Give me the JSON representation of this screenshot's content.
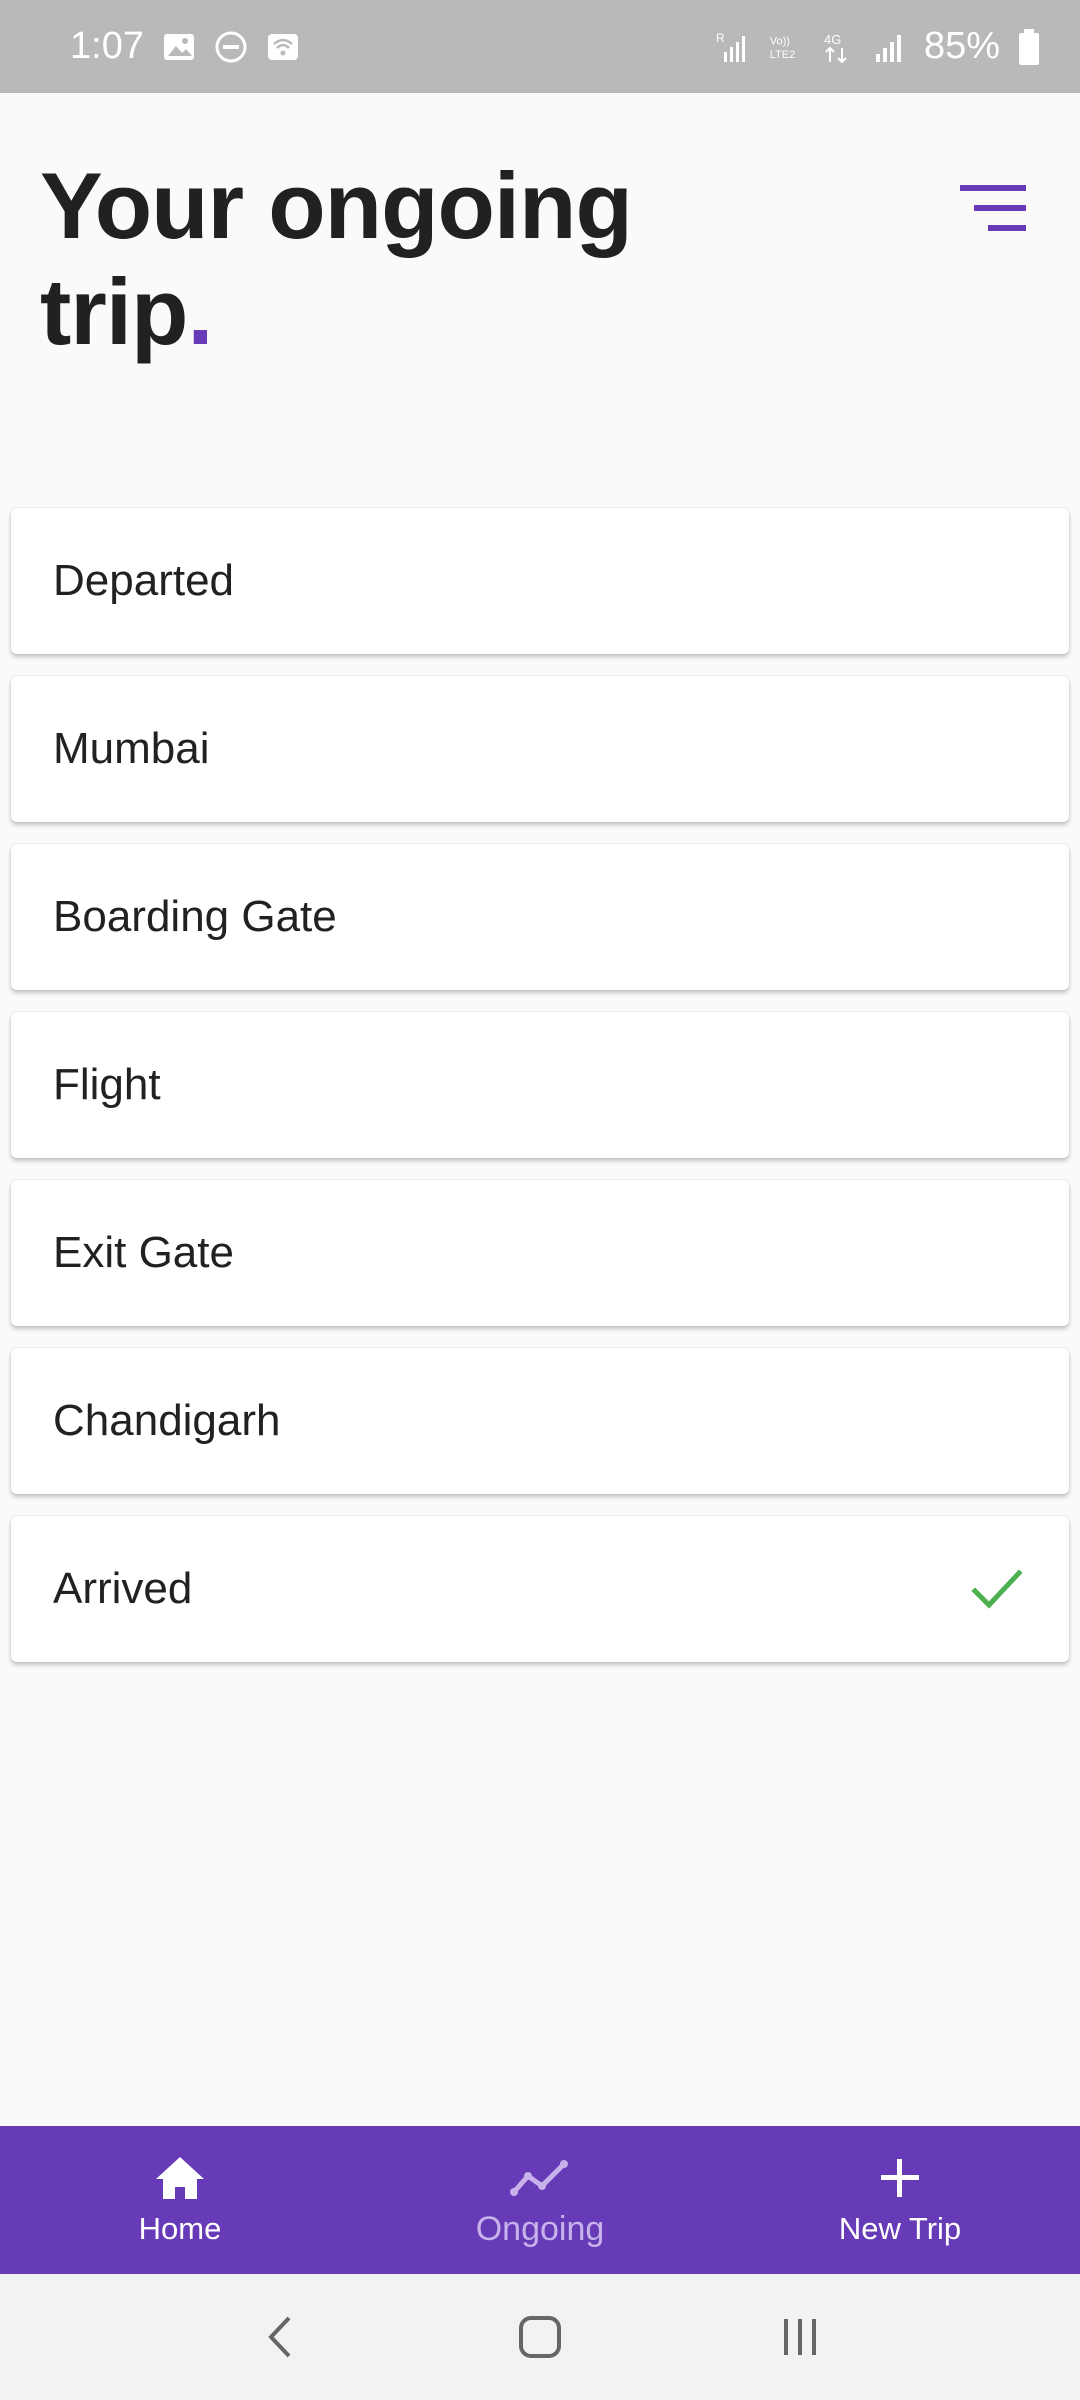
{
  "status_bar": {
    "time": "1:07",
    "battery_percent": "85%",
    "network_labels": [
      "R",
      "Vo))",
      "LTE2",
      "4G"
    ]
  },
  "header": {
    "title_line1": "Your ongoing",
    "title_line2": "trip",
    "title_dot": "."
  },
  "trip_steps": [
    {
      "label": "Departed",
      "checked": false
    },
    {
      "label": "Mumbai",
      "checked": false
    },
    {
      "label": "Boarding Gate",
      "checked": false
    },
    {
      "label": "Flight",
      "checked": false
    },
    {
      "label": "Exit Gate",
      "checked": false
    },
    {
      "label": "Chandigarh",
      "checked": false
    },
    {
      "label": "Arrived",
      "checked": true
    }
  ],
  "bottom_nav": {
    "home_label": "Home",
    "ongoing_label": "Ongoing",
    "new_trip_label": "New Trip"
  },
  "colors": {
    "accent": "#673ab7",
    "check": "#4caf50",
    "status_bar": "#b9b9b9"
  }
}
